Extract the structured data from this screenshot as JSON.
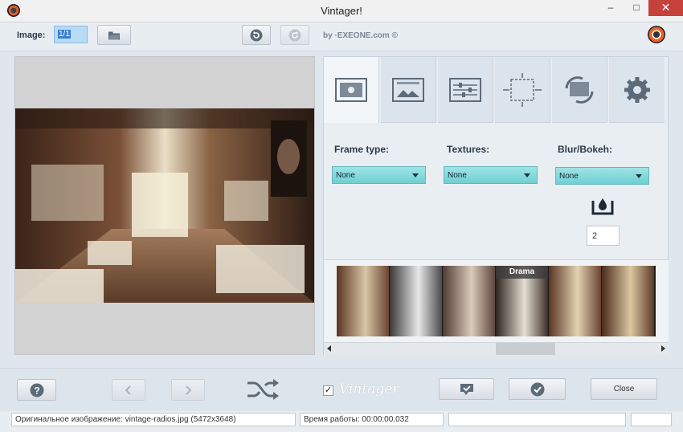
{
  "window": {
    "title": "Vintager!",
    "minimize_glyph": "–",
    "maximize_glyph": "□",
    "close_glyph": "✕"
  },
  "toolbar": {
    "image_label": "Image:",
    "image_value": "1/1",
    "brand_text": "by ·EXEONE.com ©",
    "icons": [
      "folder-icon",
      "undo-icon",
      "redo-icon",
      "app-logo"
    ]
  },
  "tabs": [
    {
      "name": "frame-tab",
      "icon": "frame-icon"
    },
    {
      "name": "textures-tab",
      "icon": "textures-icon"
    },
    {
      "name": "adjust-tab",
      "icon": "sliders-icon"
    },
    {
      "name": "crop-tab",
      "icon": "crop-icon"
    },
    {
      "name": "rotate-tab",
      "icon": "rotate-icon"
    },
    {
      "name": "settings-tab",
      "icon": "gear-icon"
    }
  ],
  "options": {
    "frame_type": {
      "label": "Frame type:",
      "value": "None"
    },
    "textures": {
      "label": "Textures:",
      "value": "None"
    },
    "blur": {
      "label": "Blur/Bokeh:",
      "value": "None"
    },
    "blur_amount": "2"
  },
  "presets": {
    "highlight_label": "Drama"
  },
  "bottom": {
    "vintager_checked": true,
    "vintager_label": "Vintager",
    "close_label": "Close"
  },
  "status": {
    "original": "Оригинальное изображение: vintage-radios.jpg (5472x3648)",
    "time": "Время работы: 00:00:00.032",
    "extra1": "",
    "extra2": ""
  },
  "colors": {
    "accent": "#6fcfd3",
    "close_red": "#c7413b"
  }
}
